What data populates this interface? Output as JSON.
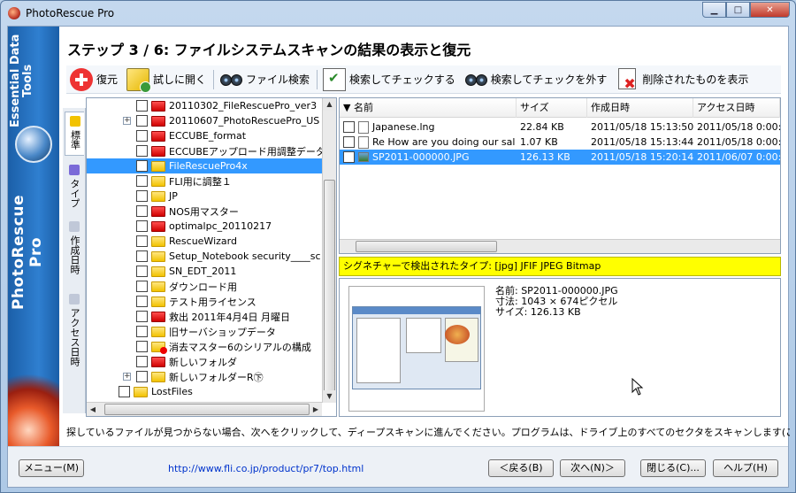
{
  "window": {
    "title": "PhotoRescue Pro"
  },
  "sidebar": {
    "brand": "Essential Data Tools",
    "product": "PhotoRescue Pro"
  },
  "heading": "ステップ 3 / 6: ファイルシステムスキャンの結果の表示と復元",
  "toolbar": {
    "restore": "復元",
    "try_open": "試しに開く",
    "file_search": "ファイル検索",
    "search_check": "検索してチェックする",
    "search_uncheck": "検索してチェックを外す",
    "show_deleted": "削除されたものを表示"
  },
  "tabs": {
    "standard": "標準",
    "type": "タイプ",
    "created": "作成日時",
    "accessed": "アクセス日時"
  },
  "tree": {
    "items": [
      {
        "label": "20110302_FileRescuePro_ver3",
        "folder": "red",
        "expander": ""
      },
      {
        "label": "20110607_PhotoRescuePro_US",
        "folder": "red",
        "expander": "+"
      },
      {
        "label": "ECCUBE_format",
        "folder": "red",
        "expander": ""
      },
      {
        "label": "ECCUBEアップロード用調整データ",
        "folder": "red",
        "expander": ""
      },
      {
        "label": "FileRescuePro4x",
        "folder": "yellow",
        "expander": "",
        "selected": true
      },
      {
        "label": "FLI用に調整１",
        "folder": "yellow",
        "expander": ""
      },
      {
        "label": "JP",
        "folder": "yellow",
        "expander": ""
      },
      {
        "label": "NOS用マスター",
        "folder": "red",
        "expander": ""
      },
      {
        "label": "optimalpc_20110217",
        "folder": "red",
        "expander": ""
      },
      {
        "label": "RescueWizard",
        "folder": "yellow",
        "expander": ""
      },
      {
        "label": "Setup_Notebook security____sc",
        "folder": "yellow",
        "expander": ""
      },
      {
        "label": "SN_EDT_2011",
        "folder": "yellow",
        "expander": ""
      },
      {
        "label": "ダウンロード用",
        "folder": "yellow",
        "expander": ""
      },
      {
        "label": "テスト用ライセンス",
        "folder": "yellow",
        "expander": ""
      },
      {
        "label": "救出 2011年4月4日 月曜日",
        "folder": "red",
        "expander": ""
      },
      {
        "label": "旧サーバショップデータ",
        "folder": "yellow",
        "expander": ""
      },
      {
        "label": "消去マスター6のシリアルの構成",
        "folder": "overlay",
        "expander": ""
      },
      {
        "label": "新しいフォルダ",
        "folder": "red",
        "expander": ""
      },
      {
        "label": "新しいフォルダーR㊦",
        "folder": "yellow",
        "expander": "+"
      },
      {
        "label": "LostFiles",
        "folder": "yellow",
        "expander": "",
        "level": 0
      }
    ]
  },
  "filelist": {
    "columns": [
      "名前",
      "サイズ",
      "作成日時",
      "アクセス日時"
    ],
    "rows": [
      {
        "name": "Japanese.lng",
        "size": "22.84 KB",
        "created": "2011/05/18 15:13:50",
        "accessed": "2011/05/18 0:00:0",
        "icon": "doc"
      },
      {
        "name": "Re How are you doing our sal",
        "size": "1.07 KB",
        "created": "2011/05/18 15:13:44",
        "accessed": "2011/05/18 0:00:0",
        "icon": "doc"
      },
      {
        "name": "SP2011-000000.JPG",
        "size": "126.13 KB",
        "created": "2011/05/18 15:20:14",
        "accessed": "2011/06/07 0:00:0",
        "icon": "image",
        "selected": true
      }
    ]
  },
  "signature": "シグネチャーで検出されたタイプ: [jpg] JFIF JPEG Bitmap",
  "preview": {
    "name_line": "名前: SP2011-000000.JPG",
    "dims_line": "寸法: 1043 × 674ピクセル",
    "size_line": "サイズ: 126.13 KB"
  },
  "status_message": "探しているファイルが見つからない場合、次へをクリックして、ディープスキャンに進んでください。プログラムは、ドライブ上のすべてのセクタをスキャンします(この処理は時間がかかります",
  "bottom": {
    "menu": "メニュー(M)",
    "url": "http://www.fli.co.jp/product/pr7/top.html",
    "back": "＜戻る(B)",
    "next": "次へ(N)＞",
    "close": "閉じる(C)...",
    "help": "ヘルプ(H)"
  }
}
